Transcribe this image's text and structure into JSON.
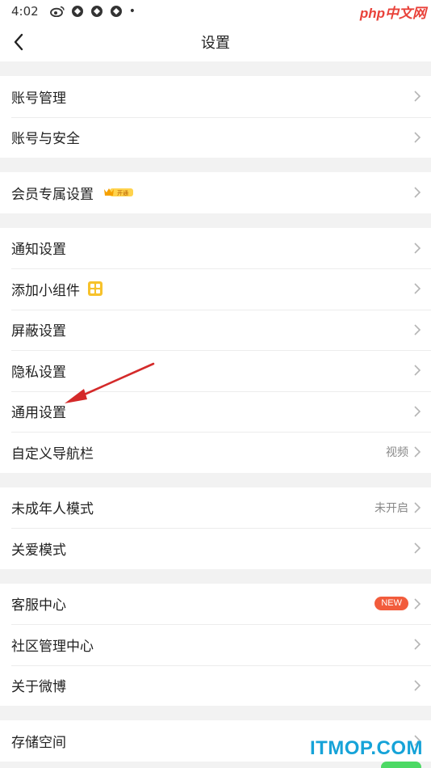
{
  "status_bar": {
    "time": "4:02",
    "dot": "•",
    "icons": [
      "weibo-icon",
      "sync-icon",
      "sync-icon",
      "sync-icon"
    ]
  },
  "watermark_top": {
    "php": "php",
    "cn": "中文网"
  },
  "nav": {
    "title": "设置",
    "back_icon": "chevron-left-icon"
  },
  "groups": [
    {
      "items": [
        {
          "label": "账号管理"
        },
        {
          "label": "账号与安全"
        }
      ]
    },
    {
      "items": [
        {
          "label": "会员专属设置",
          "badge": "开通"
        }
      ]
    },
    {
      "items": [
        {
          "label": "通知设置"
        },
        {
          "label": "添加小组件"
        },
        {
          "label": "屏蔽设置"
        },
        {
          "label": "隐私设置"
        },
        {
          "label": "通用设置"
        },
        {
          "label": "自定义导航栏",
          "value": "视频"
        }
      ]
    },
    {
      "items": [
        {
          "label": "未成年人模式",
          "value": "未开启"
        },
        {
          "label": "关爱模式"
        }
      ]
    },
    {
      "items": [
        {
          "label": "客服中心",
          "badge": "NEW"
        },
        {
          "label": "社区管理中心"
        },
        {
          "label": "关于微博"
        }
      ]
    },
    {
      "items": [
        {
          "label": "存储空间"
        }
      ]
    }
  ],
  "colors": {
    "accent_red": "#e9423a",
    "new_badge": "#f25c3c",
    "vip_gold": "#f5b400",
    "watermark_blue": "#16a3d8",
    "annotation_arrow": "#d42a2a"
  },
  "watermark_bottom": "ITMOP.COM"
}
